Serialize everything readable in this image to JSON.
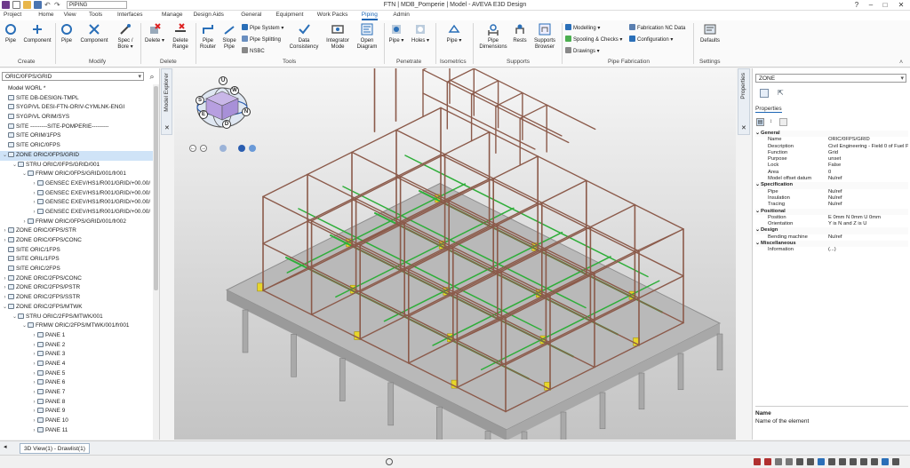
{
  "window": {
    "title": "FTN | MDB_Pomperie | Model - AVEVA E3D Design",
    "module_combo": "PIPING"
  },
  "tabs": [
    "Project",
    "Home",
    "View",
    "Tools",
    "Interfaces",
    "Manage",
    "Design Aids",
    "General",
    "Equipment",
    "Work Packs",
    "Piping",
    "Admin"
  ],
  "active_tab": "Piping",
  "ribbon": {
    "create": {
      "label": "Create",
      "pipe": "Pipe",
      "component": "Component"
    },
    "modify": {
      "label": "Modify",
      "pipe": "Pipe",
      "component": "Component",
      "spec_bore": "Spec / Bore ▾"
    },
    "delete": {
      "label": "Delete",
      "delete": "Delete ▾",
      "delete_range": "Delete Range"
    },
    "tools": {
      "label": "Tools",
      "pipe_router": "Pipe Router",
      "slope_pipe": "Slope Pipe",
      "pipe_system": "Pipe System ▾",
      "pipe_splitting": "Pipe Splitting",
      "nsbc": "NSBC",
      "data_consistency": "Data Consistency",
      "integrator_mode": "Integrator Mode",
      "open_diagram": "Open Diagram"
    },
    "penetrate": {
      "label": "Penetrate",
      "pipe": "Pipe ▾",
      "holes": "Holes ▾"
    },
    "isometrics": {
      "label": "Isometrics",
      "pipe": "Pipe ▾"
    },
    "supports": {
      "label": "Supports",
      "pipe_dimensions": "Pipe Dimensions",
      "rests": "Rests",
      "supports_browser": "Supports Browser"
    },
    "pipe_fabrication": {
      "label": "Pipe Fabrication",
      "modelling": "Modelling ▾",
      "spooling_checks": "Spooling & Checks ▾",
      "drawings": "Drawings ▾",
      "fabrication_nc_data": "Fabrication NC Data",
      "configuration": "Configuration ▾"
    },
    "settings": {
      "label": "Settings",
      "defaults": "Defaults"
    }
  },
  "explorer": {
    "combo_value": "ORIC/0FPS/GRID",
    "side_tab": "Model Explorer",
    "nodes": [
      {
        "text": "Model WORL *",
        "level": 0,
        "arrow": "",
        "icon": false
      },
      {
        "text": "SITE DB-DESIGN-TMPL",
        "level": 0,
        "arrow": "",
        "icon": true
      },
      {
        "text": "SYGP/VL DESI-FTN-ORIV-CYMLNK-ENGI",
        "level": 0,
        "arrow": "",
        "icon": true
      },
      {
        "text": "SYGP/VL ORIM/SYS",
        "level": 0,
        "arrow": "",
        "icon": true
      },
      {
        "text": "SITE ---------SITE-POMPERIE---------",
        "level": 0,
        "arrow": "",
        "icon": true
      },
      {
        "text": "SITE ORIM/1FPS",
        "level": 0,
        "arrow": "",
        "icon": true
      },
      {
        "text": "SITE ORIC/0FPS",
        "level": 0,
        "arrow": "",
        "icon": true
      },
      {
        "text": "ZONE ORIC/0FPS/GRID",
        "level": 0,
        "arrow": "⌄",
        "icon": true,
        "selected": true
      },
      {
        "text": "STRU ORIC/0FPS/GRID/001",
        "level": 1,
        "arrow": "⌄",
        "icon": true
      },
      {
        "text": "FRMW ORIC/0FPS/GRID/001/fr001",
        "level": 2,
        "arrow": "⌄",
        "icon": true
      },
      {
        "text": "GENSEC EXEV/HS1/R001/GRID/+00.00/",
        "level": 3,
        "arrow": "›",
        "icon": true
      },
      {
        "text": "GENSEC EXEV/HS1/R001/GRID/+00.00/",
        "level": 3,
        "arrow": "›",
        "icon": true
      },
      {
        "text": "GENSEC EXEV/HS1/R001/GRID/+00.00/",
        "level": 3,
        "arrow": "›",
        "icon": true
      },
      {
        "text": "GENSEC EXEV/HS1/R001/GRID/+00.00/",
        "level": 3,
        "arrow": "›",
        "icon": true
      },
      {
        "text": "FRMW ORIC/0FPS/GRID/001/fr002",
        "level": 2,
        "arrow": "›",
        "icon": true
      },
      {
        "text": "ZONE ORIC/0FPS/STR",
        "level": 0,
        "arrow": "›",
        "icon": true
      },
      {
        "text": "ZONE ORIC/0FPS/CONC",
        "level": 0,
        "arrow": "›",
        "icon": true
      },
      {
        "text": "SITE ORIC/1FPS",
        "level": 0,
        "arrow": "",
        "icon": true
      },
      {
        "text": "SITE ORIL/1FPS",
        "level": 0,
        "arrow": "",
        "icon": true
      },
      {
        "text": "SITE ORIC/2FPS",
        "level": 0,
        "arrow": "",
        "icon": true
      },
      {
        "text": "ZONE ORIC/2FPS/CONC",
        "level": 0,
        "arrow": "›",
        "icon": true
      },
      {
        "text": "ZONE ORIC/2FPS/PSTR",
        "level": 0,
        "arrow": "›",
        "icon": true
      },
      {
        "text": "ZONE ORIC/2FPS/SSTR",
        "level": 0,
        "arrow": "›",
        "icon": true
      },
      {
        "text": "ZONE ORIC/2FPS/MTWK",
        "level": 0,
        "arrow": "⌄",
        "icon": true
      },
      {
        "text": "STRU ORIC/2FPS/MTWK/001",
        "level": 1,
        "arrow": "⌄",
        "icon": true
      },
      {
        "text": "FRMW ORIC/2FPS/MTWK/001/fr001",
        "level": 2,
        "arrow": "⌄",
        "icon": true
      },
      {
        "text": "PANE 1",
        "level": 3,
        "arrow": "›",
        "icon": true
      },
      {
        "text": "PANE 2",
        "level": 3,
        "arrow": "›",
        "icon": true
      },
      {
        "text": "PANE 3",
        "level": 3,
        "arrow": "›",
        "icon": true
      },
      {
        "text": "PANE 4",
        "level": 3,
        "arrow": "›",
        "icon": true
      },
      {
        "text": "PANE 5",
        "level": 3,
        "arrow": "›",
        "icon": true
      },
      {
        "text": "PANE 6",
        "level": 3,
        "arrow": "›",
        "icon": true
      },
      {
        "text": "PANE 7",
        "level": 3,
        "arrow": "›",
        "icon": true
      },
      {
        "text": "PANE 8",
        "level": 3,
        "arrow": "›",
        "icon": true
      },
      {
        "text": "PANE 9",
        "level": 3,
        "arrow": "›",
        "icon": true
      },
      {
        "text": "PANE 10",
        "level": 3,
        "arrow": "›",
        "icon": true
      },
      {
        "text": "PANE 11",
        "level": 3,
        "arrow": "›",
        "icon": true
      }
    ]
  },
  "viewcube": {
    "labels": [
      "U",
      "W",
      "S",
      "E",
      "N",
      "D"
    ]
  },
  "properties": {
    "side_tab": "Properties",
    "combo_value": "ZONE",
    "tab_title": "Properties",
    "rows": [
      {
        "type": "cat",
        "key": "General"
      },
      {
        "key": "Name",
        "value": "ORIC/0FPS/GRID"
      },
      {
        "key": "Description",
        "value": "Civil Engineering - Field 0 of Fuel Pu"
      },
      {
        "key": "Function",
        "value": "Grid"
      },
      {
        "key": "Purpose",
        "value": "unset"
      },
      {
        "key": "Lock",
        "value": "False"
      },
      {
        "key": "Area",
        "value": "0"
      },
      {
        "key": "Model offset datum",
        "value": "Nulref"
      },
      {
        "type": "cat",
        "key": "Specification"
      },
      {
        "key": "Pipe",
        "value": "Nulref"
      },
      {
        "key": "Insulation",
        "value": "Nulref"
      },
      {
        "key": "Tracing",
        "value": "Nulref"
      },
      {
        "type": "cat",
        "key": "Positional"
      },
      {
        "key": "Position",
        "value": "E 0mm N 0mm U 0mm"
      },
      {
        "key": "Orientation",
        "value": "Y is N and Z is U"
      },
      {
        "type": "cat",
        "key": "Design"
      },
      {
        "key": "Bending machine",
        "value": "Nulref"
      },
      {
        "type": "cat",
        "key": "Miscellaneous"
      },
      {
        "key": "Information",
        "value": "(...)"
      }
    ],
    "desc_title": "Name",
    "desc_text": "Name of the element"
  },
  "bottom": {
    "doc_tab": "3D View(1) - Drawlist(1)"
  },
  "colors": {
    "accent": "#1c66b5",
    "steel": "#8b5a4a",
    "pipe": "#2fae3a",
    "equipment": "#e8d62a",
    "concrete": "#a9a9a9"
  }
}
